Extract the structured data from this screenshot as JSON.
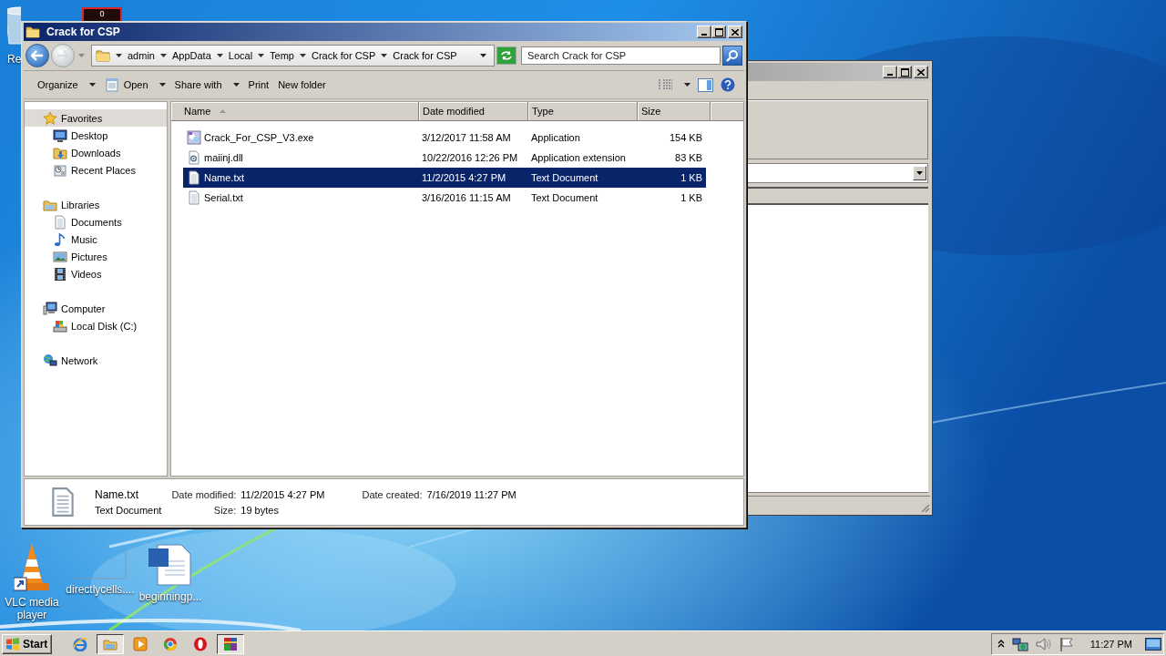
{
  "desktop": {
    "gadget": {
      "text": "0"
    },
    "icons": [
      {
        "label": "Re"
      },
      {
        "label": "VLC media player"
      },
      {
        "label": "directlycells...."
      },
      {
        "label": "beginningp..."
      }
    ]
  },
  "explorer": {
    "title": "Crack for CSP",
    "breadcrumbs": [
      "admin",
      "AppData",
      "Local",
      "Temp",
      "Crack for CSP",
      "Crack for CSP"
    ],
    "search": {
      "placeholder": "Search Crack for CSP"
    },
    "commands": [
      {
        "label": "Organize",
        "dropdown": true
      },
      {
        "label": "Open",
        "dropdown": true
      },
      {
        "label": "Share with",
        "dropdown": true
      },
      {
        "label": "Print",
        "dropdown": false
      },
      {
        "label": "New folder",
        "dropdown": false
      }
    ],
    "navigation": [
      {
        "label": "Favorites",
        "selected": true,
        "children": [
          {
            "label": "Desktop",
            "selected": false
          },
          {
            "label": "Downloads",
            "selected": false
          },
          {
            "label": "Recent Places",
            "selected": false
          }
        ]
      },
      {
        "label": "Libraries",
        "selected": false,
        "children": [
          {
            "label": "Documents",
            "selected": false
          },
          {
            "label": "Music",
            "selected": false
          },
          {
            "label": "Pictures",
            "selected": false
          },
          {
            "label": "Videos",
            "selected": false
          }
        ]
      },
      {
        "label": "Computer",
        "selected": false,
        "children": [
          {
            "label": "Local Disk (C:)",
            "selected": false
          }
        ]
      },
      {
        "label": "Network",
        "selected": false
      }
    ],
    "columns": [
      {
        "label": "Name",
        "sorted": true
      },
      {
        "label": "Date modified",
        "sorted": false
      },
      {
        "label": "Type",
        "sorted": false
      },
      {
        "label": "Size",
        "sorted": false
      }
    ],
    "files": [
      {
        "name": "Crack_For_CSP_V3.exe",
        "date_modified": "3/12/2017 11:58 AM",
        "type": "Application",
        "size": "154 KB",
        "selected": false
      },
      {
        "name": "maiinj.dll",
        "date_modified": "10/22/2016 12:26 PM",
        "type": "Application extension",
        "size": "83 KB",
        "selected": false
      },
      {
        "name": "Name.txt",
        "date_modified": "11/2/2015 4:27 PM",
        "type": "Text Document",
        "size": "1 KB",
        "selected": true
      },
      {
        "name": "Serial.txt",
        "date_modified": "3/16/2016 11:15 AM",
        "type": "Text Document",
        "size": "1 KB",
        "selected": false
      }
    ],
    "details": {
      "name": "Name.txt",
      "type": "Text Document",
      "fields": [
        {
          "label": "Date modified:",
          "value": "11/2/2015 4:27 PM"
        },
        {
          "label": "Size:",
          "value": "19 bytes"
        },
        {
          "label": "Date created:",
          "value": "7/16/2019 11:27 PM"
        }
      ]
    }
  },
  "taskbar": {
    "start": "Start",
    "clock": "11:27 PM"
  }
}
